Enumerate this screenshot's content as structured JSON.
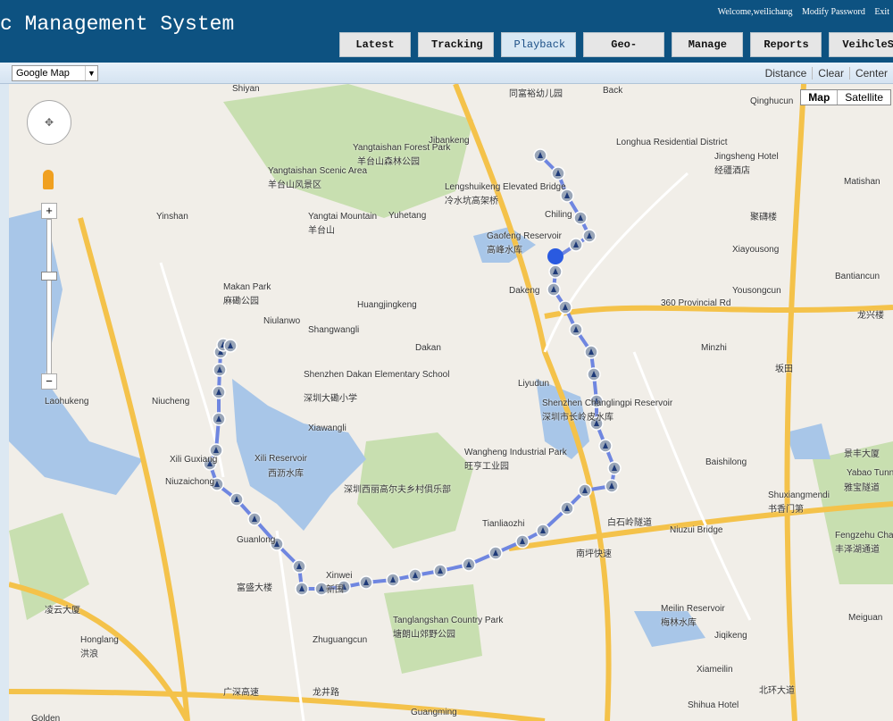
{
  "header": {
    "title": "c Management System",
    "welcome": "Welcome,weilichang",
    "modify_password": "Modify Password",
    "exit": "Exit"
  },
  "nav": [
    {
      "label": "Latest"
    },
    {
      "label": "Tracking"
    },
    {
      "label": "Playback",
      "active": true
    },
    {
      "label": "Geo-fence"
    },
    {
      "label": "Manage"
    },
    {
      "label": "Reports"
    },
    {
      "label": "VeihcleState"
    }
  ],
  "toolbar": {
    "map_select": "Google Map",
    "distance": "Distance",
    "clear": "Clear",
    "center": "Center"
  },
  "map": {
    "type_map": "Map",
    "type_satellite": "Satellite",
    "route_color": "#6f86e0",
    "marker_color": "#9aa6b8",
    "labels": [
      "Shiyan",
      "同富裕幼儿园",
      "Back",
      "Qinghucun",
      "Yangtaishan Forest Park",
      "羊台山森林公园",
      "Yangtaishan Scenic Area",
      "羊台山风景区",
      "Jibankeng",
      "Lengshuikeng Elevated Bridge",
      "冷水坑高架桥",
      "Longhua Residential District",
      "Jingsheng Hotel",
      "经疆酒店",
      "Matishan",
      "Yinshan",
      "Yangtai Mountain",
      "羊台山",
      "Yuhetang",
      "Chiling",
      "Gaofeng Reservoir",
      "高峰水库",
      "聚礴楼",
      "Xiayousong",
      "Makan Park",
      "麻磡公园",
      "Niulanwo",
      "Huangjingkeng",
      "Dakeng",
      "360 Provincial Rd",
      "Yousongcun",
      "Bantiancun",
      "龙兴楼",
      "Shangwangli",
      "Dakan",
      "Shenzhen Dakan Elementary School",
      "深圳大磡小学",
      "Minzhi",
      "坂田",
      "Liyudun",
      "Shenzhen Changlingpi Reservoir",
      "深圳市长岭皮水库",
      "Laohukeng",
      "Niucheng",
      "Xiawangli",
      "Xili Reservoir",
      "西沥水库",
      "Wangheng Industrial Park",
      "旺亨工业园",
      "Baishilong",
      "景丰大厦",
      "Yabao Tunnel",
      "雅宝隧道",
      "Xili Guxiang",
      "Niuzaichong",
      "深圳西丽高尔夫乡村俱乐部",
      "Tianliaozhi",
      "白石岭隧道",
      "Niuzui Bridge",
      "Shuxiangmendi",
      "书香门第",
      "Fengzehu Channel",
      "丰泽湖通道",
      "Guanlong",
      "富盛大楼",
      "Xinwei",
      "新围",
      "南坪快速",
      "Tanglangshan Country Park",
      "塘朗山郊野公园",
      "Zhuguangcun",
      "Meilin Reservoir",
      "梅林水库",
      "Jiqikeng",
      "Meiguan",
      "Honglang",
      "洪浪",
      "凌云大厦",
      "Xiameilin",
      "Shihua Hotel",
      "北环大道",
      "Golden",
      "广深高速",
      "龙井路",
      "Guangming"
    ]
  }
}
